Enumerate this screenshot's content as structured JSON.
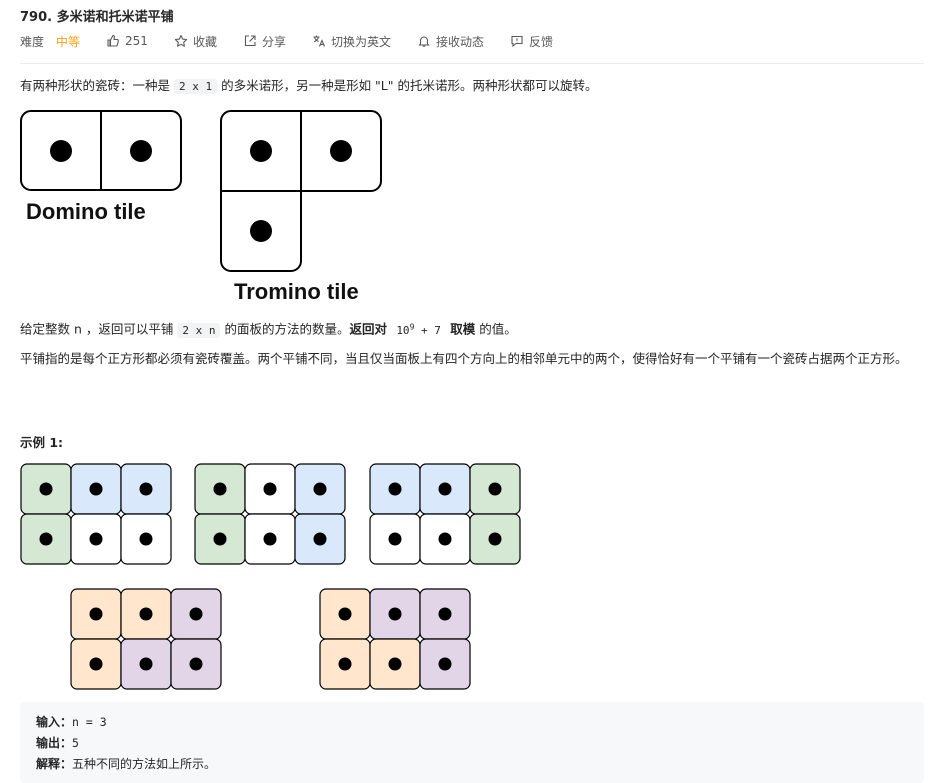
{
  "problem": {
    "title": "790. 多米诺和托米诺平铺",
    "difficulty_label": "难度",
    "difficulty_value": "中等",
    "likes": "251",
    "favorite": "收藏",
    "share": "分享",
    "switch_lang": "切换为英文",
    "subscribe": "接收动态",
    "feedback": "反馈"
  },
  "desc": {
    "p1_a": "有两种形状的瓷砖：一种是 ",
    "p1_code": "2 x 1",
    "p1_b": " 的多米诺形，另一种是形如 \"L\" 的托米诺形。两种形状都可以旋转。",
    "p2_a": "给定整数 n ，返回可以平铺 ",
    "p2_code": "2 x n",
    "p2_b": " 的面板的方法的数量。",
    "p2_bold": "返回对 ",
    "p2_mod_base": "10",
    "p2_mod_exp": "9",
    "p2_mod_plus": " + 7",
    "p2_bold2": " 取模",
    "p2_c": " 的值。",
    "p3": "平铺指的是每个正方形都必须有瓷砖覆盖。两个平铺不同，当且仅当面板上有四个方向上的相邻单元中的两个，使得恰好有一个平铺有一个瓷砖占据两个正方形。"
  },
  "figure": {
    "domino_label": "Domino tile",
    "tromino_label": "Tromino tile"
  },
  "example": {
    "title": "示例 1:",
    "input_label": "输入：",
    "input_value": "n = 3",
    "output_label": "输出：",
    "output_value": "5",
    "explain_label": "解释：",
    "explain_value": "五种不同的方法如上所示。"
  },
  "colors": {
    "green": "#d5e8d4",
    "blue": "#dae8fc",
    "orange": "#ffe6cc",
    "purple": "#e1d5e7",
    "white": "#ffffff",
    "accent": "#ffa116"
  }
}
